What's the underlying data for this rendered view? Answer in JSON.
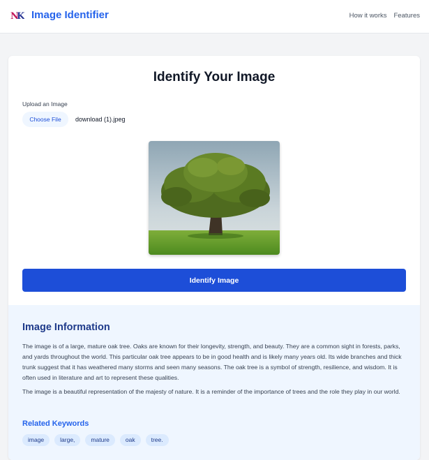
{
  "header": {
    "logo_text": "NK",
    "brand": "Image Identifier",
    "nav": [
      "How it works",
      "Features"
    ]
  },
  "main": {
    "title": "Identify Your Image",
    "upload_label": "Upload an Image",
    "choose_file_label": "Choose File",
    "file_name": "download (1).jpeg",
    "preview_image": "oak-tree-photo",
    "identify_button": "Identify Image"
  },
  "info": {
    "title": "Image Information",
    "paragraph1": "The image is of a large, mature oak tree. Oaks are known for their longevity, strength, and beauty. They are a common sight in forests, parks, and yards throughout the world. This particular oak tree appears to be in good health and is likely many years old. Its wide branches and thick trunk suggest that it has weathered many storms and seen many seasons. The oak tree is a symbol of strength, resilience, and wisdom. It is often used in literature and art to represent these qualities.",
    "paragraph2": "The image is a beautiful representation of the majesty of nature. It is a reminder of the importance of trees and the role they play in our world.",
    "keywords_title": "Related Keywords",
    "keywords": [
      "image",
      "large,",
      "mature",
      "oak",
      "tree."
    ]
  },
  "colors": {
    "accent": "#2563eb",
    "button": "#1d4ed8",
    "info_bg": "#eff6ff",
    "keyword_bg": "#dbeafe"
  }
}
